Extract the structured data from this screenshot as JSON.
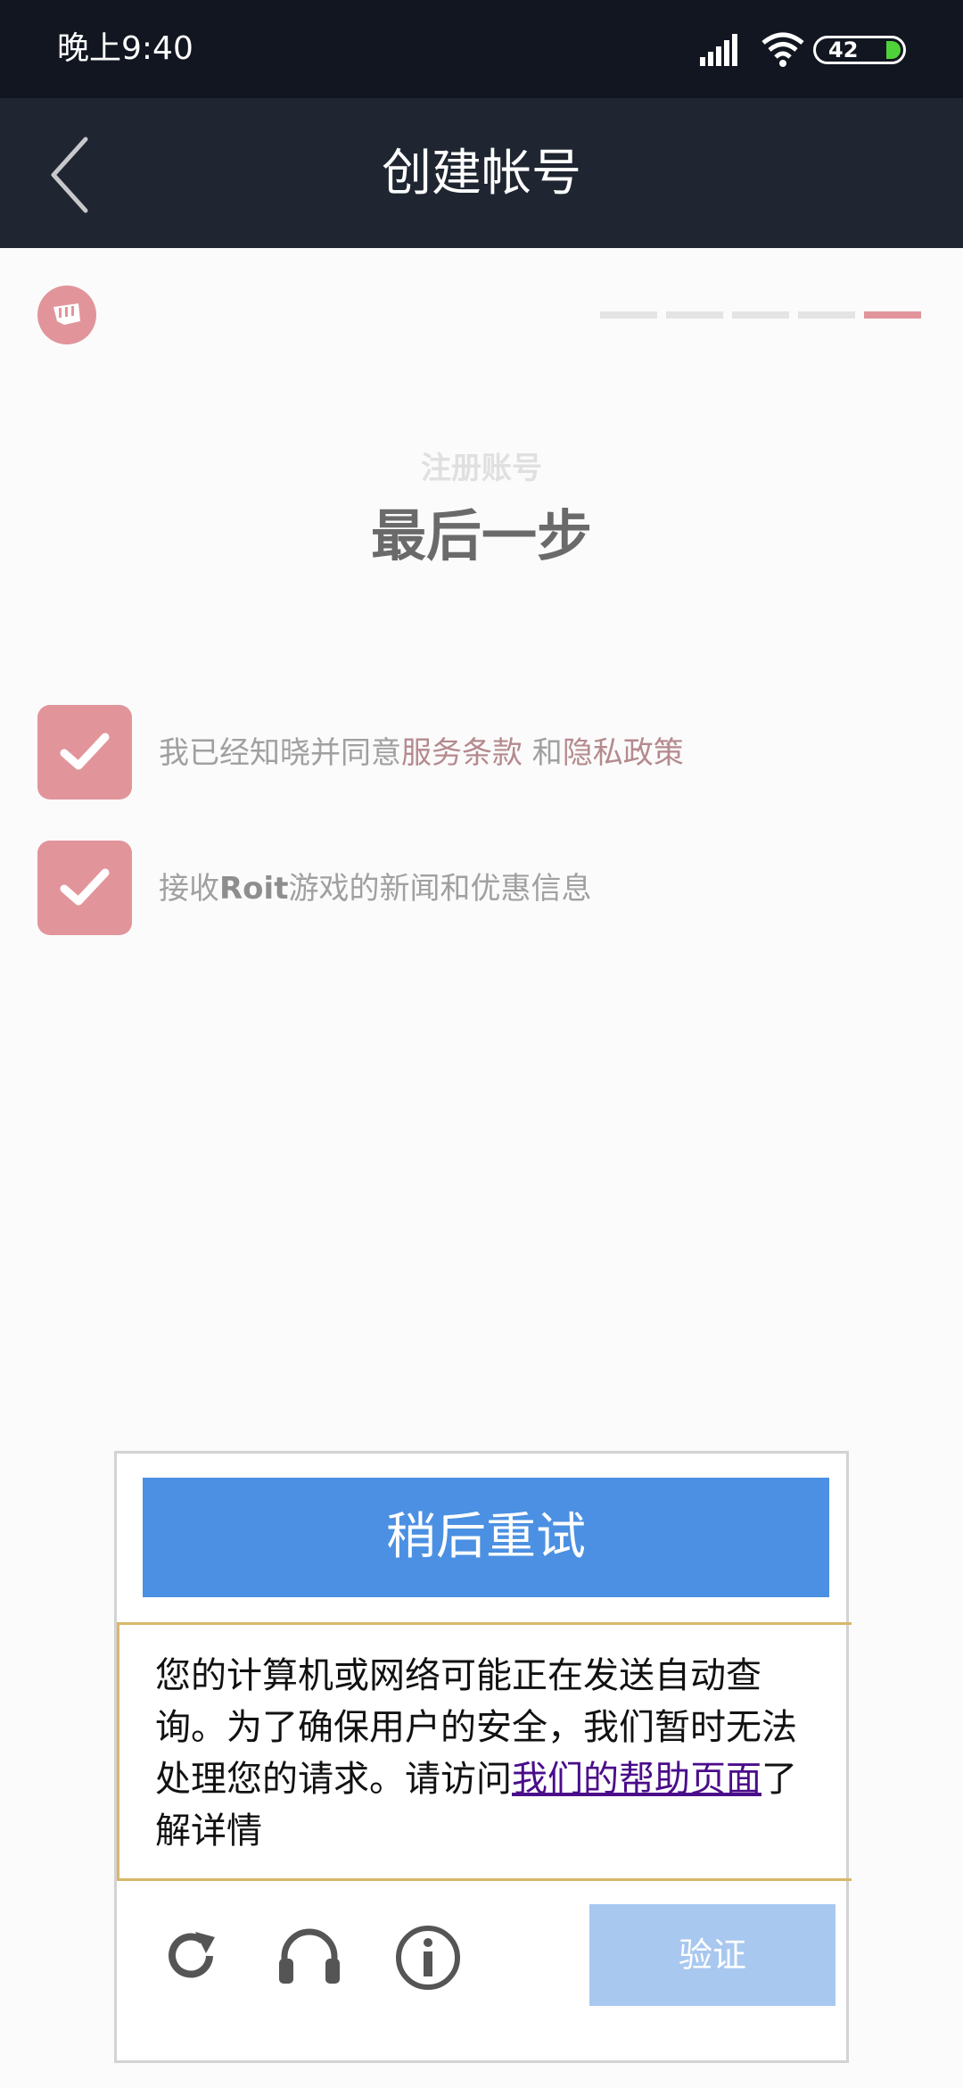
{
  "status_bar": {
    "time": "晚上9:40",
    "battery": "42",
    "icons": [
      "signal-icon",
      "wifi-icon",
      "battery-icon"
    ]
  },
  "header": {
    "title": "创建帐号",
    "back_icon": "chevron-left-icon"
  },
  "progress": {
    "total_steps": 5,
    "current_step": 5
  },
  "section": {
    "subtitle": "注册账号",
    "title": "最后一步"
  },
  "checkboxes": {
    "terms": {
      "checked": true,
      "prefix": "我已经知晓并同意",
      "terms_link": "服务条款",
      "and": " 和",
      "privacy_link": "隐私政策"
    },
    "news": {
      "checked": true,
      "prefix": "接收",
      "brand": "Roit",
      "suffix": "游戏的新闻和优惠信息"
    }
  },
  "captcha": {
    "retry_label": "稍后重试",
    "message": "您的计算机或网络可能正在发送自动查询。为了确保用户的安全，我们暂时无法处理您的请求。请访问",
    "help_link": "我们的帮助页面",
    "message_suffix": "了解详情",
    "verify_label": "验证",
    "tools": [
      "reload-icon",
      "headphones-icon",
      "info-icon"
    ]
  },
  "colors": {
    "accent": "#e1959b",
    "header_bg": "#202631",
    "status_bg": "#121621",
    "button_blue": "#4b90e2",
    "verify_disabled": "#a9c8f0"
  }
}
